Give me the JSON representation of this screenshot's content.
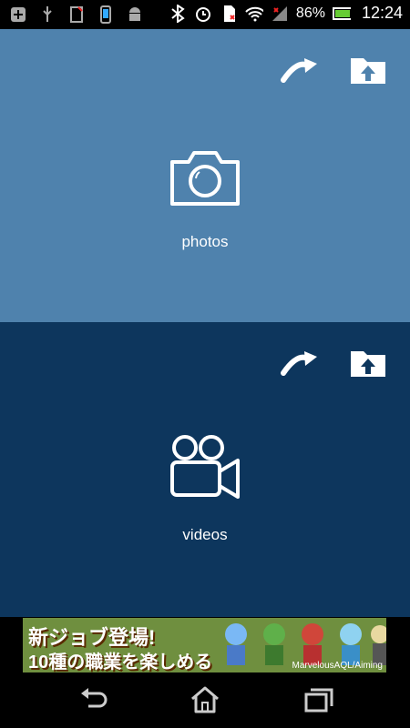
{
  "status_bar": {
    "battery": "86%",
    "time": "12:24",
    "icons": [
      "plus-icon",
      "usb-icon",
      "sim-icon",
      "phone-icon",
      "android-icon",
      "bluetooth-icon",
      "alarm-icon",
      "sd-card-icon",
      "wifi-icon",
      "signal-icon",
      "battery-icon"
    ]
  },
  "panels": [
    {
      "label": "photos",
      "icon": "camera-icon",
      "actions": [
        "share-icon",
        "upload-folder-icon"
      ]
    },
    {
      "label": "videos",
      "icon": "video-camera-icon",
      "actions": [
        "share-icon",
        "upload-folder-icon"
      ]
    }
  ],
  "ad": {
    "headline": "新ジョブ登場!",
    "subline": "10種の職業を楽しめる",
    "credit": "MarvelousAQL/Aiming"
  },
  "nav_bar": {
    "buttons": [
      "back-icon",
      "home-icon",
      "recent-apps-icon"
    ]
  },
  "colors": {
    "photos_bg": "#4f82ad",
    "videos_bg": "#0d365d"
  }
}
